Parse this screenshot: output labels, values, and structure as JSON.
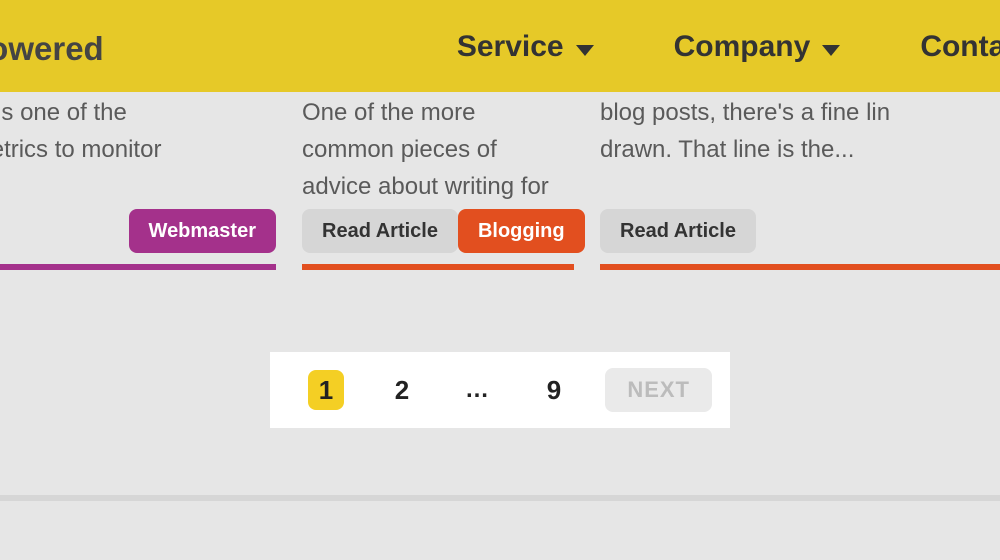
{
  "header": {
    "brand": "t Powered",
    "nav": [
      {
        "label": "Service",
        "has_caret": true
      },
      {
        "label": "Company",
        "has_caret": true
      },
      {
        "label": "Contac",
        "has_caret": false
      }
    ]
  },
  "cards": [
    {
      "excerpt": "rough rate is one of the\nant web metrics to monitor",
      "read_label": "",
      "tag_label": "Webmaster",
      "tag_style": "purple",
      "accent": "#a4318b"
    },
    {
      "excerpt": "One of the more common pieces of\nadvice about writing for your blog is to",
      "read_label": "Read Article",
      "tag_label": "Blogging",
      "tag_style": "orange",
      "accent": "#e24f1f"
    },
    {
      "excerpt": "blog posts, there's a fine lin\ndrawn. That line is the...",
      "read_label": "Read Article",
      "tag_label": "",
      "tag_style": "",
      "accent": "#e24f1f"
    }
  ],
  "pagination": {
    "current": "1",
    "pages": [
      "1",
      "2",
      "…",
      "9"
    ],
    "next_label": "NEXT"
  }
}
